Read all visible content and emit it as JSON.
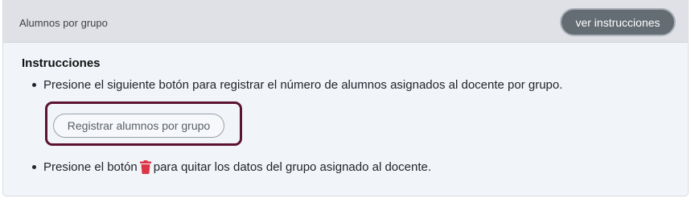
{
  "header": {
    "title": "Alumnos por grupo",
    "instructions_button": "ver instrucciones"
  },
  "body": {
    "instructions_title": "Instrucciones",
    "bullet1": "Presione el siguiente botón para registrar el número de alumnos asignados al docente por grupo.",
    "register_button": "Registrar alumnos por grupo",
    "bullet2_before": "Presione el botón",
    "bullet2_icon": "trash-icon",
    "bullet2_after": "para quitar los datos del grupo asignado al docente."
  },
  "colors": {
    "header_bg": "#dfe1e6",
    "body_bg": "#f1f5fa",
    "instructions_button_bg": "#646c74",
    "highlight_border": "#5b1330",
    "trash_icon": "#dc3545"
  }
}
